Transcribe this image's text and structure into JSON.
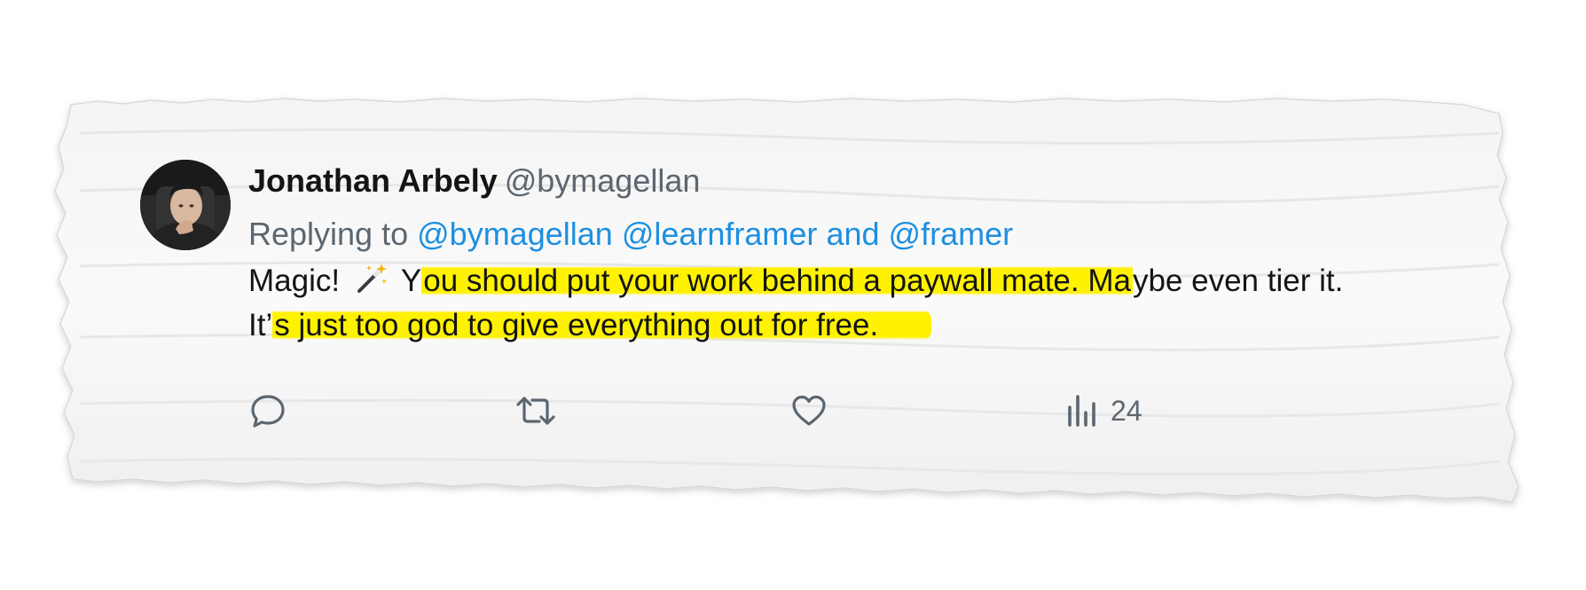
{
  "tweet": {
    "author_name": "Jonathan Arbely",
    "author_handle": "@bymagellan",
    "replying_prefix": "Replying to",
    "mentions": {
      "first": "@bymagellan",
      "second": "@learnframer",
      "conjunction": "and",
      "third": "@framer"
    },
    "body": {
      "lead": "Magic!",
      "emoji": "magic-wand-emoji",
      "part1_plain": "Y",
      "part1_highlight": "ou should put your work behind a paywall mate. Ma",
      "part1_rest": "ybe even tier it. It’",
      "part2_highlight": "s just too god to give everything out for free."
    },
    "actions": {
      "reply_icon": "speech-bubble-icon",
      "retweet_icon": "retweet-icon",
      "like_icon": "heart-icon",
      "views_icon": "bar-chart-icon",
      "views_count": "24"
    }
  },
  "colors": {
    "highlight": "#fff200",
    "mention": "#1d8fe0",
    "secondary_text": "#5b6670",
    "primary_text": "#141414"
  }
}
